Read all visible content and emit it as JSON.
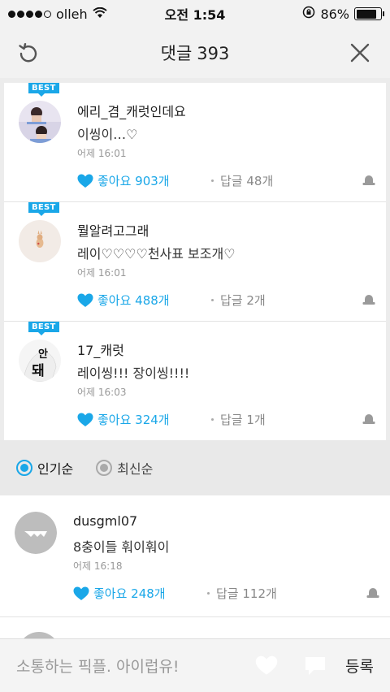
{
  "status_bar": {
    "carrier": "olleh",
    "time": "오전 1:54",
    "battery": "86%",
    "battery_level": 0.86
  },
  "header": {
    "title": "댓글",
    "count": "393"
  },
  "best_badge": "BEST",
  "best_comments": [
    {
      "nickname": "에리_겸_캐럿인데요",
      "text": "이씽이…♡",
      "date": "어제 16:01",
      "likes": "좋아요 903개",
      "replies": "답글 48개"
    },
    {
      "nickname": "뭘알려고그래",
      "text": "레이♡♡♡♡천사표 보조개♡",
      "date": "어제 16:01",
      "likes": "좋아요 488개",
      "replies": "답글 2개"
    },
    {
      "nickname": "17_캐럿",
      "text": "레이씽!!! 장이씽!!!!",
      "date": "어제 16:03",
      "likes": "좋아요 324개",
      "replies": "답글 1개"
    }
  ],
  "avatar3_text": {
    "top": "안",
    "bottom": "돼"
  },
  "sort": {
    "popular": "인기순",
    "latest": "최신순",
    "selected": "popular"
  },
  "comments": [
    {
      "nickname": "dusgml07",
      "text": "8충이들 훠이훠이",
      "date": "어제 16:18",
      "likes": "좋아요 248개",
      "replies": "답글 112개"
    }
  ],
  "input": {
    "placeholder": "소통하는 픽플. 아이럽유!",
    "submit": "등록"
  },
  "colors": {
    "accent": "#1aa7e8",
    "badge": "#1aa7e8"
  }
}
